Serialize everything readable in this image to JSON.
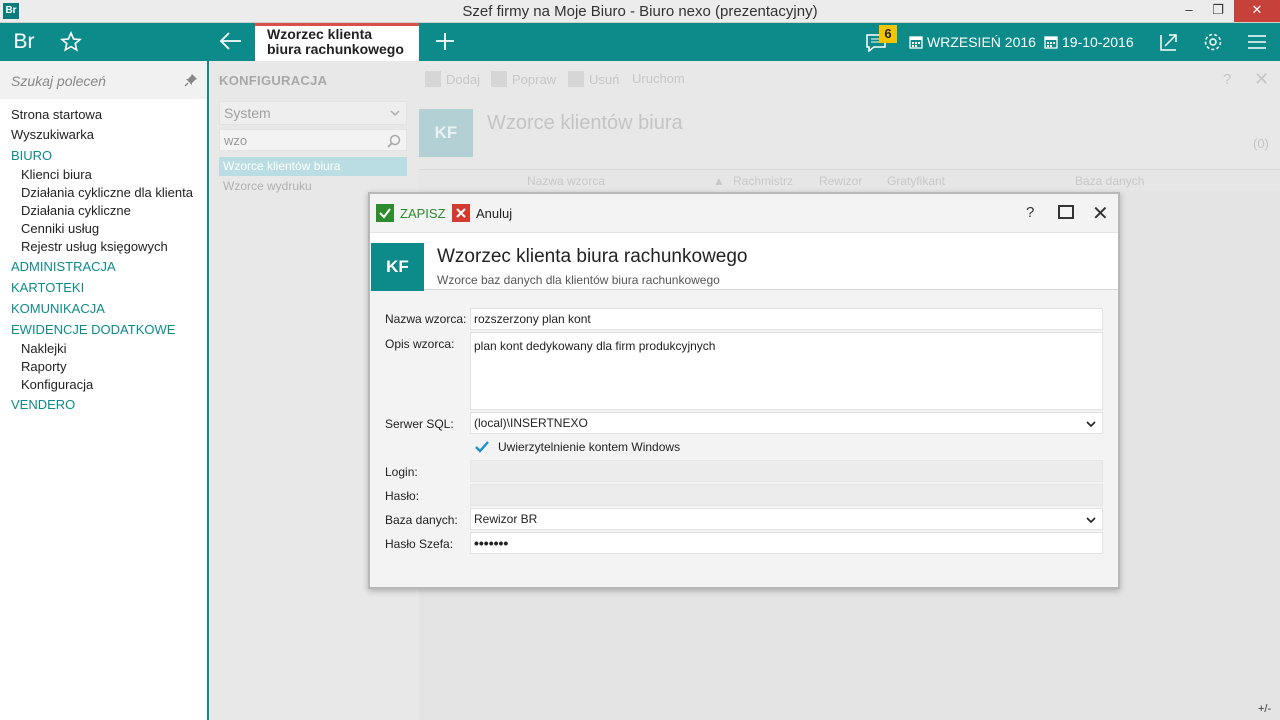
{
  "window": {
    "title": "Szef firmy na Moje Biuro - Biuro nexo (prezentacyjny)",
    "app_icon": "Br",
    "minimize": "‒",
    "restore": "❐",
    "close": "✕"
  },
  "topbar": {
    "logo": "Br",
    "tab_label": "Wzorzec klienta biura rachunkowego",
    "notification_count": "6",
    "month": "WRZESIEŃ 2016",
    "date": "19-10-2016"
  },
  "sidebar": {
    "search_placeholder": "Szukaj poleceń",
    "items": [
      {
        "label": "Strona startowa"
      },
      {
        "label": "Wyszukiwarka"
      },
      {
        "label": "BIURO"
      },
      {
        "label": "Klienci biura"
      },
      {
        "label": "Działania cykliczne dla klienta"
      },
      {
        "label": "Działania cykliczne"
      },
      {
        "label": "Cenniki usług"
      },
      {
        "label": "Rejestr usług księgowych"
      },
      {
        "label": "ADMINISTRACJA"
      },
      {
        "label": "KARTOTEKI"
      },
      {
        "label": "KOMUNIKACJA"
      },
      {
        "label": "EWIDENCJE DODATKOWE"
      },
      {
        "label": "Naklejki"
      },
      {
        "label": "Raporty"
      },
      {
        "label": "Konfiguracja"
      },
      {
        "label": "VENDERO"
      }
    ]
  },
  "config": {
    "header": "KONFIGURACJA",
    "group_select": "System",
    "search_value": "wzo",
    "items": [
      "Wzorce klientów biura",
      "Wzorce wydruku"
    ]
  },
  "main": {
    "toolbar": {
      "add": "Dodaj",
      "edit": "Popraw",
      "delete": "Usuń",
      "run": "Uruchom"
    },
    "help": "?",
    "close": "✕",
    "badge": "KF",
    "title": "Wzorce klientów biura",
    "count": "(0)",
    "columns": [
      "Nazwa wzorca",
      "Rachmistrz",
      "Rewizor",
      "Gratyfikant",
      "Baza danych"
    ],
    "corner": "+/-"
  },
  "dialog": {
    "save": "ZAPISZ",
    "cancel": "Anuluj",
    "help": "?",
    "close": "✕",
    "badge": "KF",
    "title": "Wzorzec klienta biura rachunkowego",
    "subtitle": "Wzorce baz danych dla klientów biura rachunkowego",
    "fields": {
      "name_label": "Nazwa wzorca:",
      "name_value": "rozszerzony plan kont",
      "desc_label": "Opis wzorca:",
      "desc_value": "plan kont dedykowany dla firm produkcyjnych",
      "server_label": "Serwer SQL:",
      "server_value": "(local)\\INSERTNEXO",
      "windows_auth_label": "Uwierzytelnienie kontem Windows",
      "login_label": "Login:",
      "login_value": "",
      "password_label": "Hasło:",
      "password_value": "",
      "db_label": "Baza danych:",
      "db_value": "Rewizor BR",
      "boss_password_label": "Hasło Szefa:",
      "boss_password_value": "•••••••"
    }
  },
  "colors": {
    "accent": "#0d8a8a",
    "active_tab_border": "#d9504a",
    "badge": "#f5c400",
    "save": "#2e8b2e",
    "cancel": "#d43a2f"
  }
}
